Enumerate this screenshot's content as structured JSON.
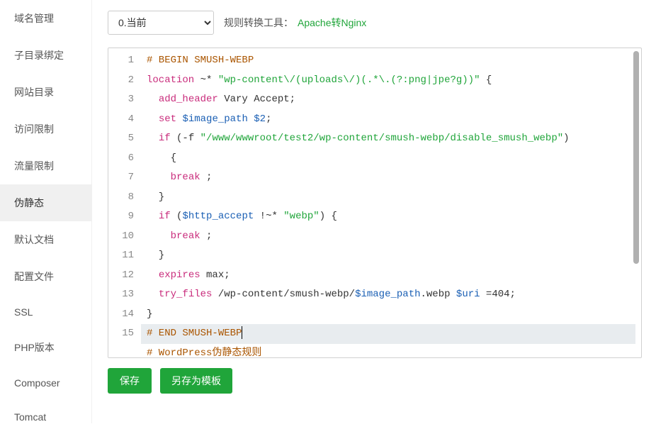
{
  "sidebar": {
    "items": [
      {
        "label": "域名管理"
      },
      {
        "label": "子目录绑定"
      },
      {
        "label": "网站目录"
      },
      {
        "label": "访问限制"
      },
      {
        "label": "流量限制"
      },
      {
        "label": "伪静态"
      },
      {
        "label": "默认文档"
      },
      {
        "label": "配置文件"
      },
      {
        "label": "SSL"
      },
      {
        "label": "PHP版本"
      },
      {
        "label": "Composer"
      },
      {
        "label": "Tomcat"
      }
    ],
    "active_index": 5
  },
  "topbar": {
    "select_value": "0.当前",
    "tool_label": "规则转换工具：",
    "tool_link": "Apache转Nginx"
  },
  "editor": {
    "lines": [
      {
        "type": "comment",
        "raw": "# BEGIN SMUSH-WEBP"
      },
      {
        "type": "location",
        "kw": "location",
        "mod": "~*",
        "str": "\"wp-content\\/(uploads\\/)(.*\\.(?:png|jpe?g))\""
      },
      {
        "type": "directive",
        "indent": 2,
        "kw": "add_header",
        "args": "Vary Accept;"
      },
      {
        "type": "set",
        "indent": 2,
        "kw": "set",
        "var": "$image_path",
        "val": "$2"
      },
      {
        "type": "if_open",
        "indent": 2,
        "kw": "if",
        "paren": "(-f",
        "str": "\"/www/wwwroot/test2/wp-content/smush-webp/disable_smush_webp\"",
        "close": ")",
        "brace_next": true
      },
      {
        "type": "directive",
        "indent": 4,
        "kw": "break",
        "args": ";"
      },
      {
        "type": "brace_close",
        "indent": 2
      },
      {
        "type": "if_webp",
        "indent": 2,
        "kw": "if",
        "paren_open": "(",
        "var": "$http_accept",
        "op": " !~*",
        "str": "\"webp\"",
        "paren_close": ")",
        "brace": " {"
      },
      {
        "type": "directive",
        "indent": 4,
        "kw": "break",
        "args": ";"
      },
      {
        "type": "brace_close",
        "indent": 2
      },
      {
        "type": "directive",
        "indent": 2,
        "kw": "expires",
        "args": "max;"
      },
      {
        "type": "try_files",
        "indent": 2,
        "kw": "try_files",
        "path": " /wp-content/smush-webp/",
        "var1": "$image_path",
        "mid": ".webp ",
        "var2": "$uri",
        "tail": " =404;"
      },
      {
        "type": "brace_close",
        "indent": 0
      },
      {
        "type": "comment",
        "raw": "# END SMUSH-WEBP",
        "active": true
      },
      {
        "type": "comment",
        "raw": "# WordPress伪静态规则"
      }
    ]
  },
  "buttons": {
    "save": "保存",
    "save_as_template": "另存为模板"
  }
}
